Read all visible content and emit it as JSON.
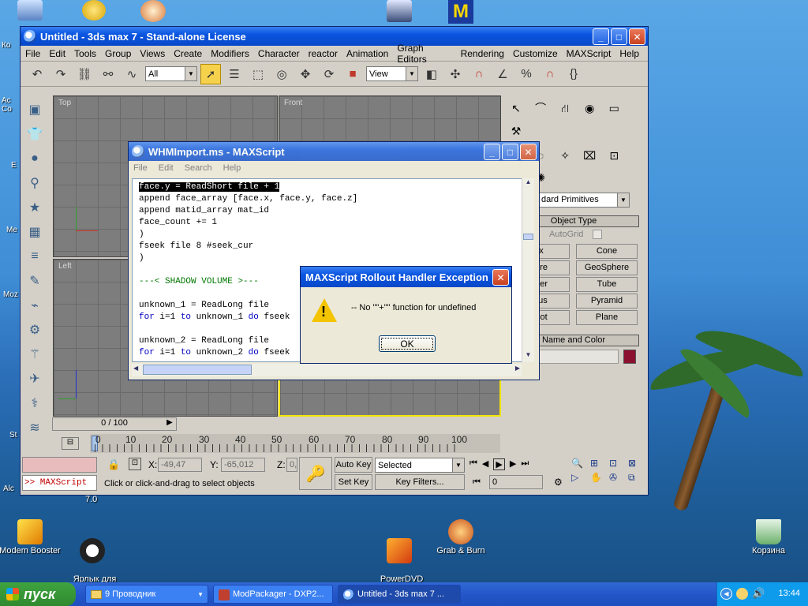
{
  "desktop": {
    "icons": [
      {
        "label": "Modem Booster"
      },
      {
        "label": "Ярлык для\nModStudio"
      },
      {
        "label": "PowerDVD\nCopy"
      },
      {
        "label": "Grab & Burn"
      },
      {
        "label": "Корзина"
      }
    ],
    "left_labels": [
      "Ко",
      "Ac\nCo",
      "E",
      "Me",
      "Moz",
      "St",
      "Alc"
    ],
    "under_window_label": "7.0"
  },
  "max_window": {
    "title": "Untitled - 3ds max 7  - Stand-alone License",
    "menu": [
      "File",
      "Edit",
      "Tools",
      "Group",
      "Views",
      "Create",
      "Modifiers",
      "Character",
      "reactor",
      "Animation",
      "Graph Editors",
      "Rendering",
      "Customize",
      "MAXScript",
      "Help"
    ],
    "selection_filter": "All",
    "reference_coord": "View",
    "viewports": {
      "top": "Top",
      "front": "Front",
      "left": "Left"
    },
    "command_panel": {
      "category": "dard Primitives",
      "rollout_object_type": "Object Type",
      "autogrid": "AutoGrid",
      "buttons": [
        "ox",
        "Cone",
        "here",
        "GeoSphere",
        "nder",
        "Tube",
        "orus",
        "Pyramid",
        "apot",
        "Plane"
      ],
      "rollout_name_color": "Name and Color",
      "object_color": "#8b1030"
    },
    "time_slider": "0 / 100",
    "track_ticks": [
      "0",
      "10",
      "20",
      "30",
      "40",
      "50",
      "60",
      "70",
      "80",
      "90",
      "100"
    ],
    "status": {
      "x_label": "X:",
      "x_value": "-49,47",
      "y_label": "Y:",
      "y_value": "-65,012",
      "z_label": "Z:",
      "z_value": "0,0",
      "auto_key": "Auto Key",
      "set_key": "Set Key",
      "key_mode": "Selected",
      "key_filters": "Key Filters...",
      "frame": "0",
      "listener": ">> MAXScript",
      "prompt": "Click or click-and-drag to select objects"
    }
  },
  "maxscript_editor": {
    "title": "WHMImport.ms - MAXScript",
    "menu": [
      "File",
      "Edit",
      "Search",
      "Help"
    ],
    "lines": [
      {
        "text": "face.y = ReadShort file + 1",
        "style": "sel"
      },
      {
        "text": "append face_array [face.x, face.y, face.z]",
        "style": ""
      },
      {
        "text": "append matid_array mat_id",
        "style": ""
      },
      {
        "text": "face_count += 1",
        "style": ""
      },
      {
        "text": ")",
        "style": ""
      },
      {
        "text": "fseek file 8 #seek_cur",
        "style": ""
      },
      {
        "text": ")",
        "style": ""
      },
      {
        "text": "",
        "style": ""
      },
      {
        "text": "---< SHADOW VOLUME >---",
        "style": "cm"
      },
      {
        "text": "",
        "style": ""
      },
      {
        "text": "unknown_1 = ReadLong file",
        "style": ""
      },
      {
        "kw1": "for",
        "mid": " i=1 ",
        "kw2": "to",
        "mid2": " unknown_1 ",
        "kw3": "do",
        "rest": " fseek",
        "style": "for"
      },
      {
        "text": "",
        "style": ""
      },
      {
        "text": "unknown_2 = ReadLong file",
        "style": ""
      },
      {
        "kw1": "for",
        "mid": " i=1 ",
        "kw2": "to",
        "mid2": " unknown_2 ",
        "kw3": "do",
        "rest": " fseek",
        "style": "for"
      }
    ]
  },
  "dialog": {
    "title": "MAXScript Rollout Handler Exception",
    "message": "-- No \"\"+\"\" function for undefined",
    "ok": "OK"
  },
  "taskbar": {
    "start": "пуск",
    "tasks": [
      {
        "label": "9 Проводник"
      },
      {
        "label": "ModPackager - DXP2..."
      },
      {
        "label": "Untitled - 3ds max 7 ..."
      }
    ],
    "lang": "RU",
    "time": "13:44"
  }
}
